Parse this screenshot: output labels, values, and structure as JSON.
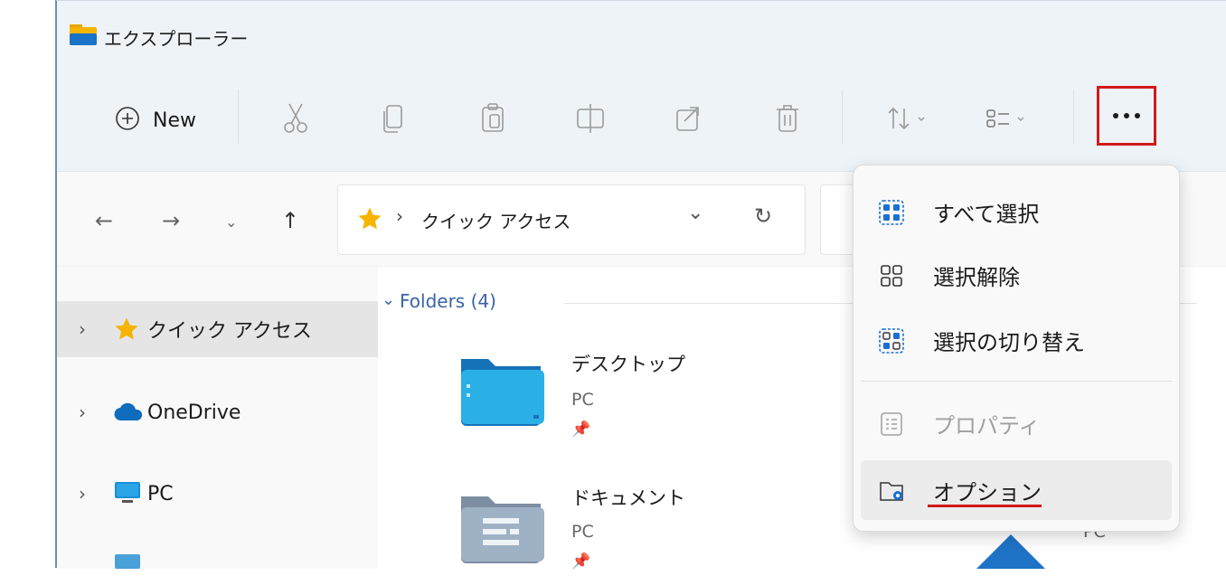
{
  "window": {
    "title": "エクスプローラー"
  },
  "toolbar": {
    "new_label": "New",
    "icons": [
      "cut-icon",
      "copy-icon",
      "paste-icon",
      "rename-icon",
      "share-icon",
      "delete-icon",
      "sort-icon",
      "view-icon"
    ],
    "more_icon": "more-icon"
  },
  "navigation": {
    "breadcrumb": "クイック アクセス",
    "breadcrumb_separator": "›"
  },
  "sidebar": {
    "items": [
      {
        "label": "クイック アクセス",
        "icon": "star-icon",
        "selected": true
      },
      {
        "label": "OneDrive",
        "icon": "cloud-icon",
        "selected": false
      },
      {
        "label": "PC",
        "icon": "monitor-icon",
        "selected": false
      }
    ]
  },
  "content": {
    "group_label": "Folders (4)",
    "folders": [
      {
        "name": "デスクトップ",
        "location": "PC",
        "icon": "desktop-folder-icon"
      },
      {
        "name": "ドキュメント",
        "location": "PC",
        "icon": "documents-folder-icon"
      }
    ],
    "partial_location": "PC"
  },
  "context_menu": {
    "items": [
      {
        "label": "すべて選択",
        "icon": "select-all-icon",
        "enabled": true
      },
      {
        "label": "選択解除",
        "icon": "select-none-icon",
        "enabled": true
      },
      {
        "label": "選択の切り替え",
        "icon": "invert-selection-icon",
        "enabled": true
      },
      {
        "label": "プロパティ",
        "icon": "properties-icon",
        "enabled": false
      },
      {
        "label": "オプション",
        "icon": "options-icon",
        "enabled": true,
        "highlighted": true
      }
    ]
  },
  "colors": {
    "highlight_red": "#d11a1a",
    "accent_blue": "#1a6fd6",
    "folder_yellow": "#f4b400"
  }
}
